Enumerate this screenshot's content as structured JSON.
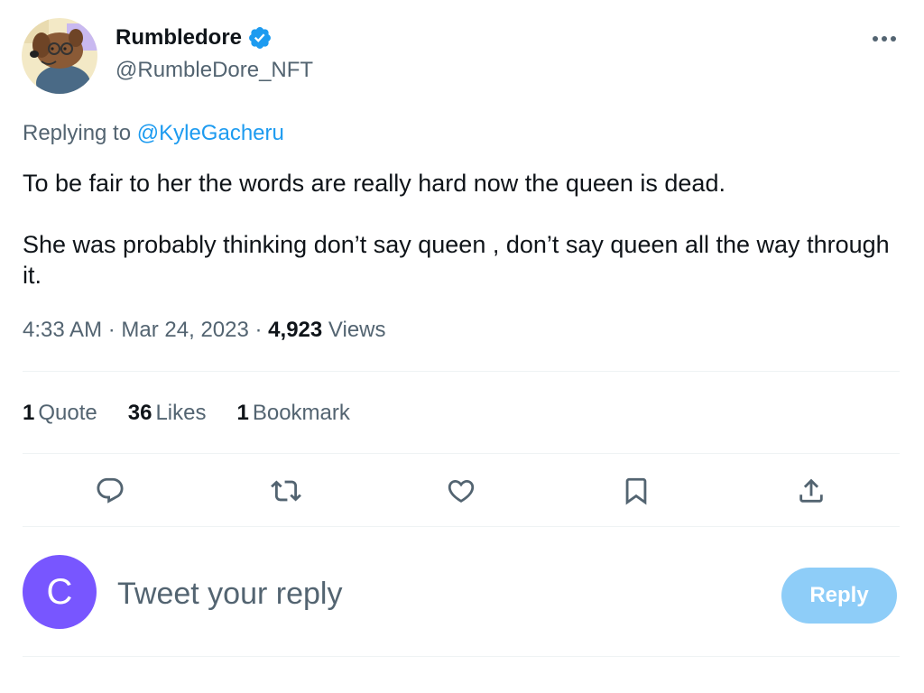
{
  "author": {
    "display_name": "Rumbledore",
    "handle": "@RumbleDore_NFT",
    "verified": true,
    "avatar_icon": "cartoon-dog-avatar"
  },
  "replying": {
    "prefix": "Replying to",
    "mention": "@KyleGacheru"
  },
  "tweet": {
    "paragraphs": [
      "To be fair to her the words are really hard now the queen is dead.",
      "She was probably thinking don’t say queen , don’t say queen all the way through it."
    ]
  },
  "meta": {
    "time": "4:33 AM",
    "separator": "·",
    "date": "Mar 24, 2023",
    "views_count": "4,923",
    "views_label": "Views"
  },
  "stats": [
    {
      "count": "1",
      "label": "Quote"
    },
    {
      "count": "36",
      "label": "Likes"
    },
    {
      "count": "1",
      "label": "Bookmark"
    }
  ],
  "actions": [
    {
      "name": "reply",
      "icon": "reply-bubble-icon"
    },
    {
      "name": "retweet",
      "icon": "retweet-icon"
    },
    {
      "name": "like",
      "icon": "heart-icon"
    },
    {
      "name": "bookmark",
      "icon": "bookmark-icon"
    },
    {
      "name": "share",
      "icon": "share-upload-icon"
    }
  ],
  "composer": {
    "avatar_letter": "C",
    "placeholder": "Tweet your reply",
    "button_label": "Reply"
  },
  "colors": {
    "accent": "#1d9bf0",
    "muted_text": "#536471",
    "reply_button_disabled": "#8ecdf8",
    "composer_avatar": "#7856ff"
  }
}
